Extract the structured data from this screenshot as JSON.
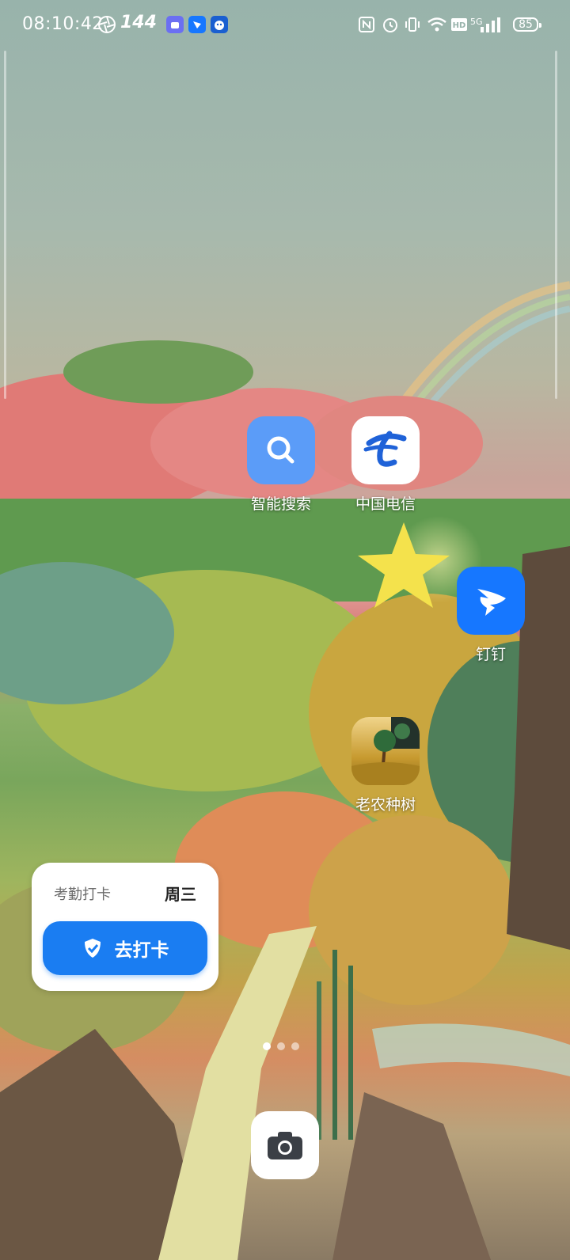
{
  "status_bar": {
    "time": "08:10:42",
    "refresh_rate": "144",
    "battery": "85",
    "network": "5G"
  },
  "apps": [
    {
      "label": "智能搜索",
      "icon": "search-icon",
      "color": "#5b9cf8"
    },
    {
      "label": "中国电信",
      "icon": "china-telecom-icon",
      "color": "#1f62d8"
    },
    {
      "label": "钉钉",
      "icon": "dingtalk-icon",
      "color": "#1677ff"
    },
    {
      "label": "老农种树",
      "icon": "farmer-tree-icon",
      "color": "#c79a2f"
    }
  ],
  "widget": {
    "title": "考勤打卡",
    "day": "周三",
    "button_label": "去打卡",
    "accent": "#1a7df2"
  },
  "dock": {
    "camera_icon": "camera-icon"
  }
}
